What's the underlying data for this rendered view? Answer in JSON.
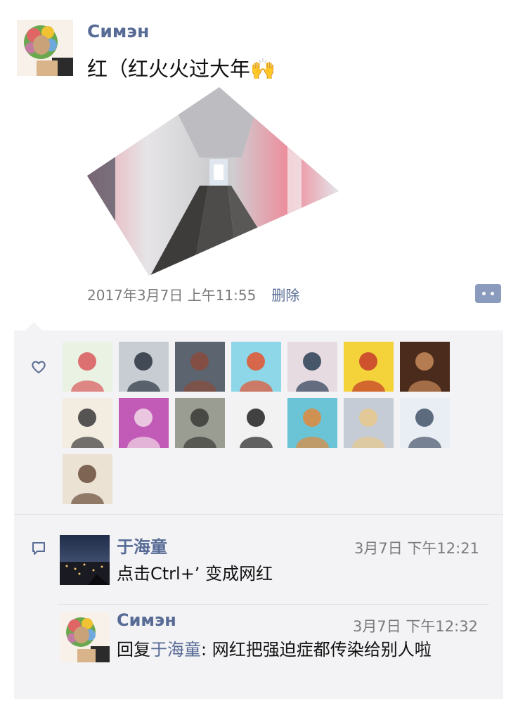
{
  "post": {
    "author": "Симэн",
    "text": "红（红火火过大年🙌",
    "time": "2017年3月7日 上午11:55",
    "delete_label": "删除"
  },
  "comments": [
    {
      "author": "于海童",
      "time": "3月7日 下午12:21",
      "text": "点击Ctrl+’ 变成网红"
    },
    {
      "author": "Симэн",
      "time": "3月7日 下午12:32",
      "reply_prefix": "回复",
      "reply_to": "于海童",
      "reply_sep": ": ",
      "text": "网红把强迫症都传染给别人啦"
    }
  ],
  "like_avatars": [
    {
      "icon": "monkey-illustration-avatar",
      "colors": [
        "#e9f2e3",
        "#d9585a"
      ]
    },
    {
      "icon": "cap-man-avatar",
      "colors": [
        "#c8cdd3",
        "#2a3340"
      ]
    },
    {
      "icon": "building-avatar",
      "colors": [
        "#5c6470",
        "#8a4b3c"
      ]
    },
    {
      "icon": "lollipops-avatar",
      "colors": [
        "#8dd7e8",
        "#e4532f"
      ]
    },
    {
      "icon": "blossom-man-avatar",
      "colors": [
        "#e6dbe0",
        "#2c3e55"
      ]
    },
    {
      "icon": "pikachu-avatar",
      "colors": [
        "#f4d33a",
        "#c53b2b"
      ]
    },
    {
      "icon": "painting-avatar",
      "colors": [
        "#4a2b1c",
        "#c88a5a"
      ]
    },
    {
      "icon": "line-face-avatar",
      "colors": [
        "#f3ece0",
        "#3a3a3a"
      ]
    },
    {
      "icon": "pink-object-avatar",
      "colors": [
        "#c25ab8",
        "#f1d9e6"
      ]
    },
    {
      "icon": "flower-woman-avatar",
      "colors": [
        "#9a9e92",
        "#3a3a36"
      ]
    },
    {
      "icon": "bw-woman-avatar",
      "colors": [
        "#f2f2f2",
        "#222222"
      ]
    },
    {
      "icon": "boy-desk-avatar",
      "colors": [
        "#6bc3d6",
        "#e28a3c"
      ]
    },
    {
      "icon": "blonde-woman-avatar",
      "colors": [
        "#c6ccd6",
        "#e7c88c"
      ]
    },
    {
      "icon": "camera-man-avatar",
      "colors": [
        "#e9eef5",
        "#44536a"
      ]
    },
    {
      "icon": "anime-girl-avatar",
      "colors": [
        "#ece2d4",
        "#6b4d3b"
      ]
    }
  ],
  "colors": {
    "link": "#576b95",
    "panel_bg": "#f3f3f5",
    "meta_gray": "#7a7a7a"
  }
}
